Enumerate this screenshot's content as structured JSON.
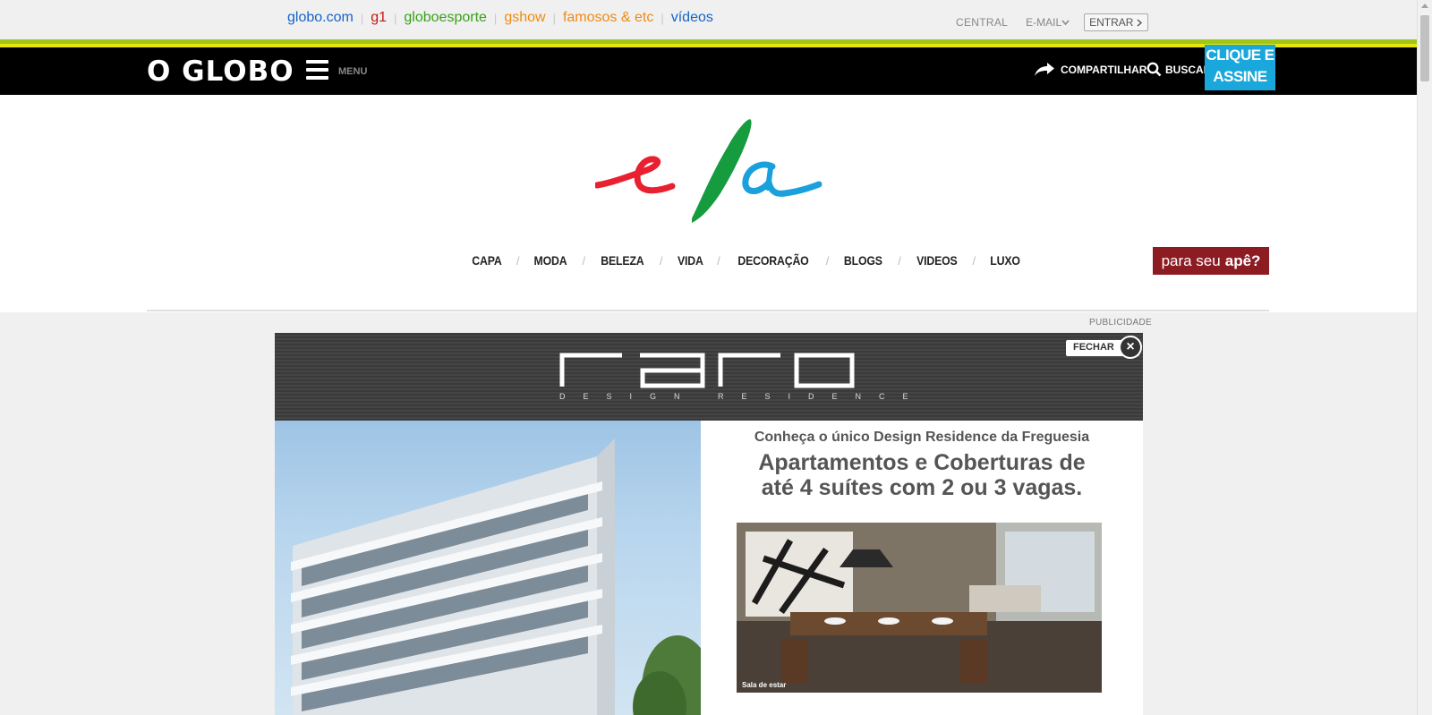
{
  "globo_bar": {
    "links": [
      {
        "label": "globo.com",
        "color": "#1563c8"
      },
      {
        "label": "g1",
        "color": "#c4170c"
      },
      {
        "label": "globoesporte",
        "color": "#39a01b"
      },
      {
        "label": "gshow",
        "color": "#f08a13"
      },
      {
        "label": "famosos & etc",
        "color": "#f08a13"
      },
      {
        "label": "vídeos",
        "color": "#1563c8"
      }
    ],
    "central": "CENTRAL",
    "email": "E-MAIL",
    "login": "ENTRAR"
  },
  "header": {
    "brand": "O GLOBO",
    "menu_label": "MENU",
    "share_label": "COMPARTILHAR",
    "search_label": "BUSCAR",
    "subscribe_line1": "CLIQUE E",
    "subscribe_line2": "ASSINE"
  },
  "ela": {
    "logo_text": "ela",
    "nav": [
      "CAPA",
      "MODA",
      "BELEZA",
      "VIDA",
      "DECORAÇÃO",
      "BLOGS",
      "VIDEOS",
      "LUXO"
    ],
    "badge_text": "para seu",
    "badge_bold": "apê?",
    "badge_color": "#8c1b22"
  },
  "ad": {
    "label": "PUBLICIDADE",
    "close_label": "FECHAR",
    "brand": "raro",
    "brand_sub": "DESIGN RESIDENCE",
    "subtitle": "Conheça o único Design Residence da Freguesia",
    "title_line1": "Apartamentos e Coberturas de",
    "title_line2": "até 4 suítes com 2 ou 3 vagas.",
    "photo_caption": "Sala de estar"
  },
  "colors": {
    "stripe_green": "#a2c617",
    "stripe_yellow": "#e6e60e",
    "subscribe_bg": "#1aa8dc",
    "logo_red": "#e8202f",
    "logo_green": "#179b3f",
    "logo_blue": "#1aa0dc"
  }
}
